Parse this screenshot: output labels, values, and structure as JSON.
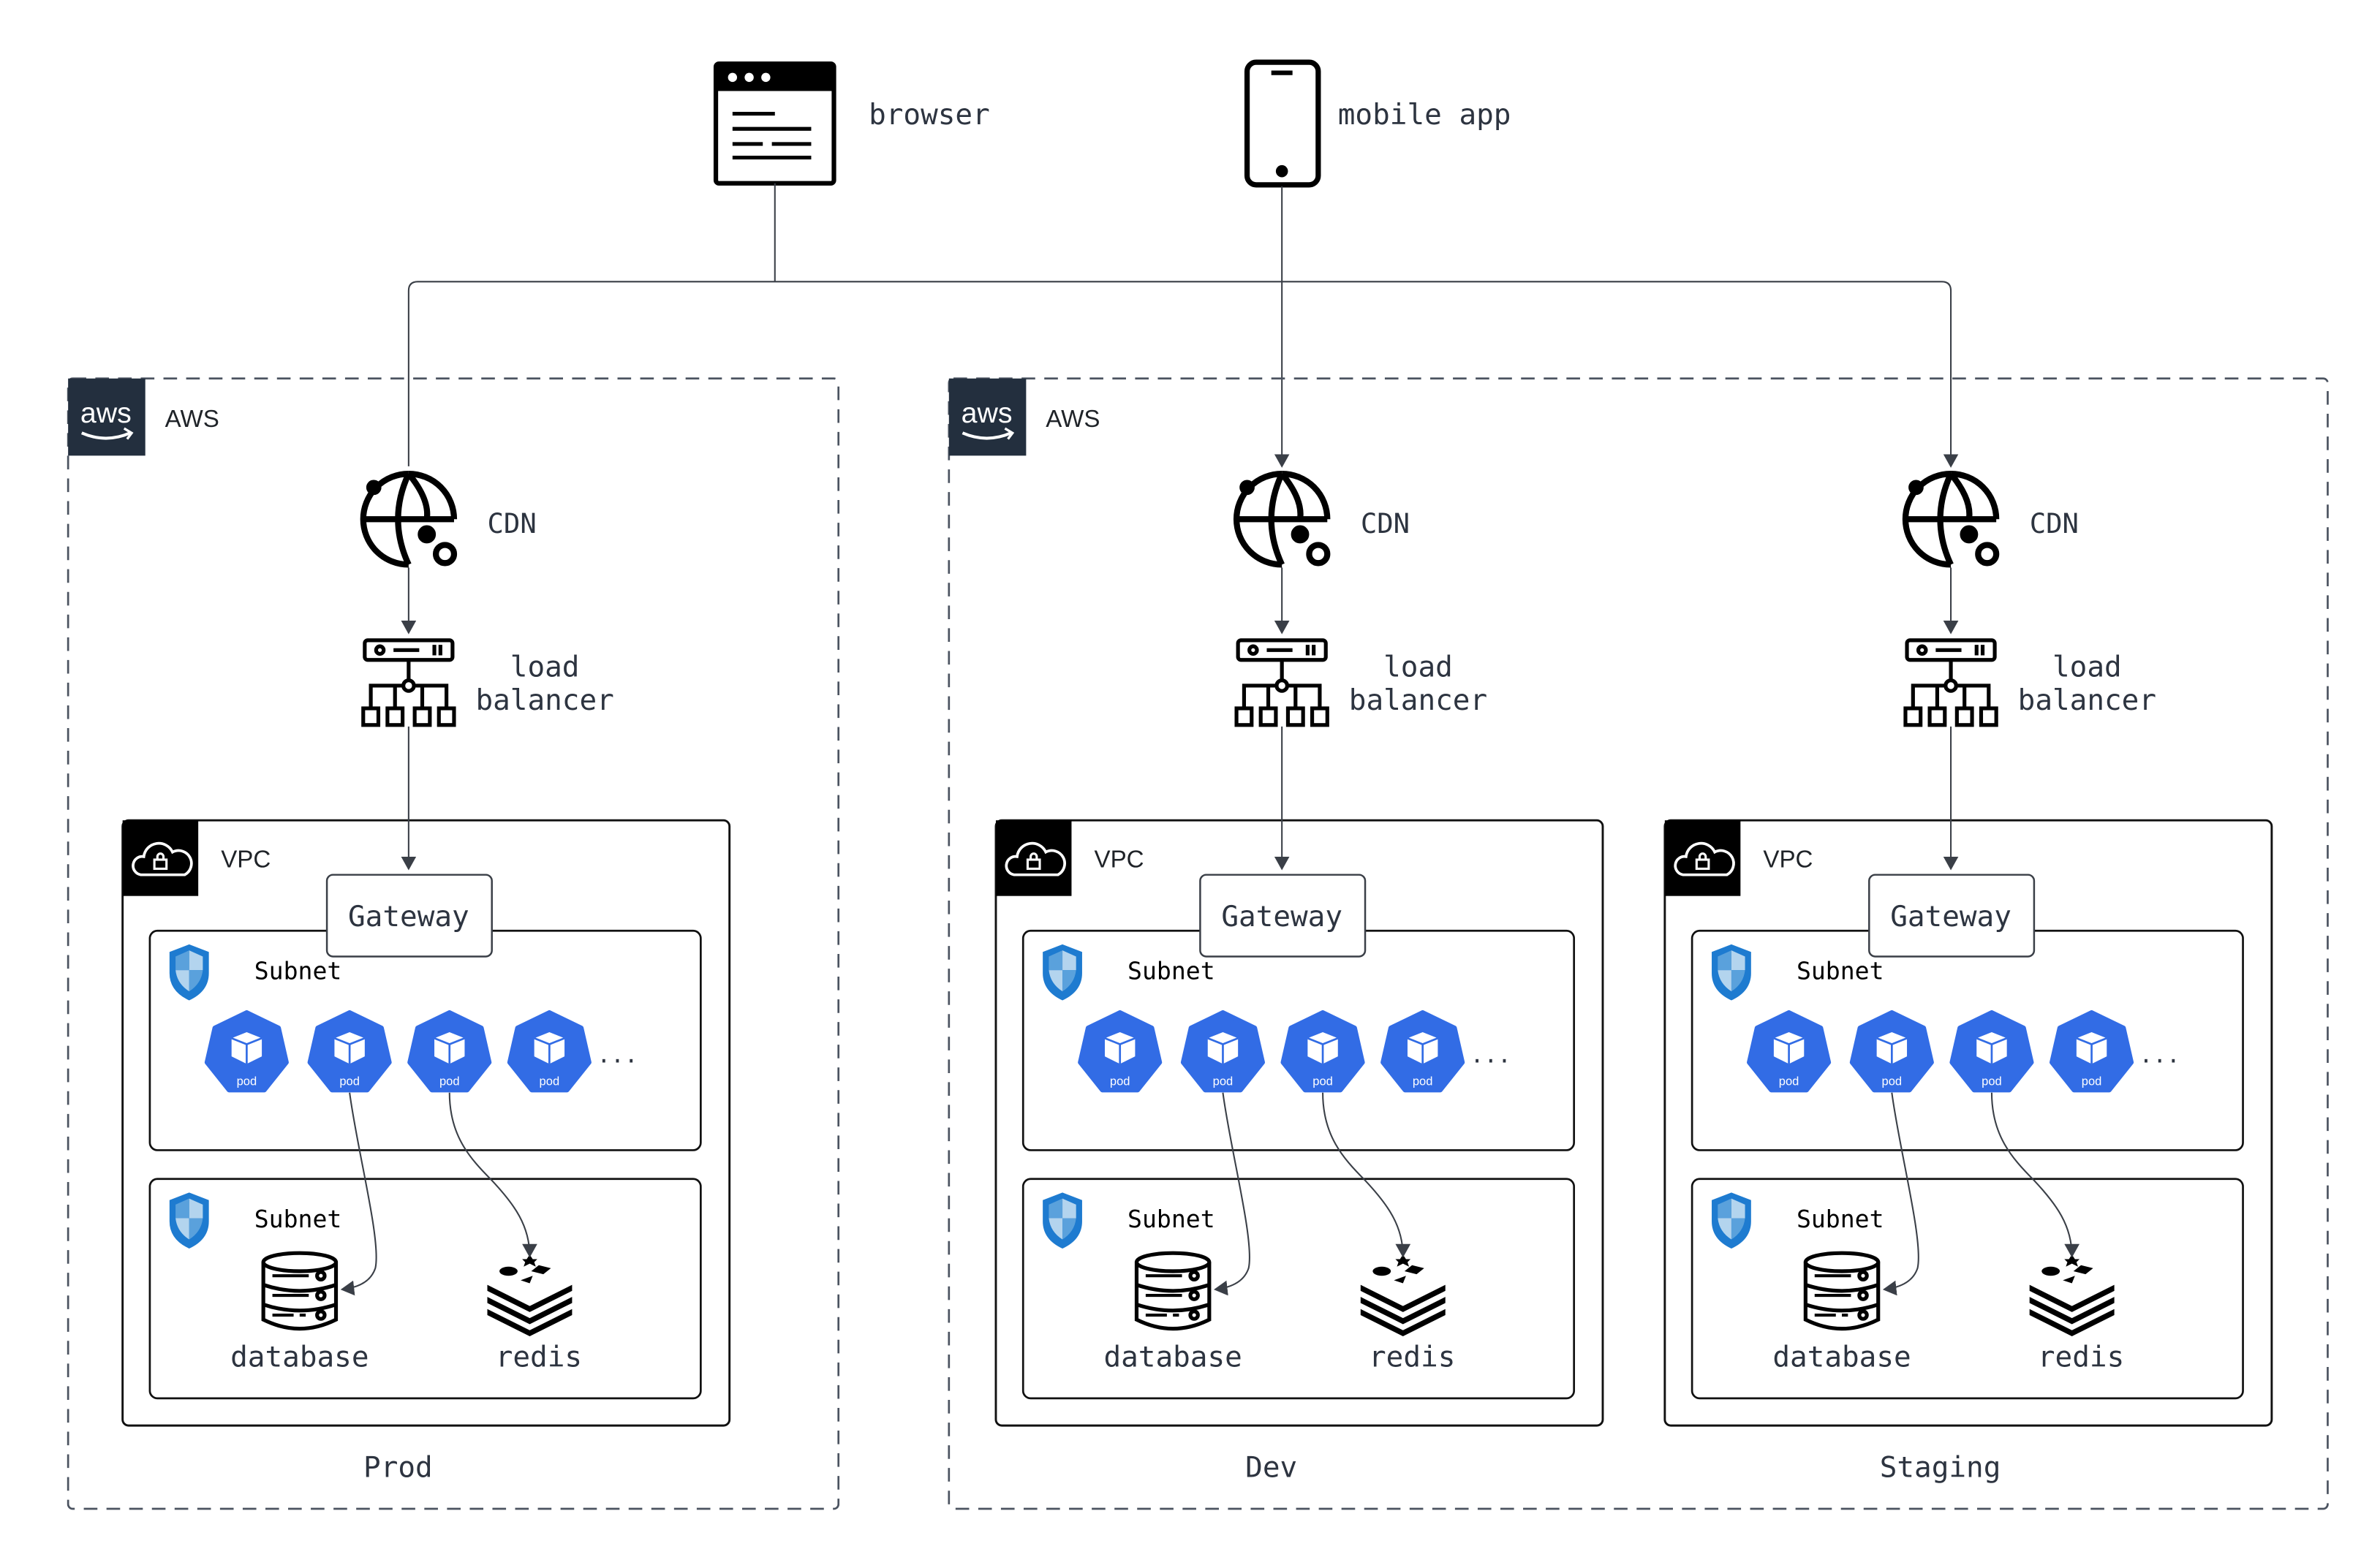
{
  "clients": {
    "browser": {
      "label": "browser",
      "icon": "browser-window-icon"
    },
    "mobile": {
      "label": "mobile app",
      "icon": "mobile-phone-icon"
    }
  },
  "providers": [
    {
      "label": "AWS",
      "logo_text": "aws",
      "icon": "aws-logo"
    },
    {
      "label": "AWS",
      "logo_text": "aws",
      "icon": "aws-logo"
    }
  ],
  "environments": [
    {
      "name": "Prod",
      "cdn": "CDN",
      "lb_line1": "load",
      "lb_line2": "balancer",
      "vpc": "VPC",
      "gateway": "Gateway",
      "subnet_app": "Subnet",
      "subnet_data": "Subnet",
      "pods": [
        "pod",
        "pod",
        "pod",
        "pod"
      ],
      "more": "...",
      "database": "database",
      "redis": "redis"
    },
    {
      "name": "Dev",
      "cdn": "CDN",
      "lb_line1": "load",
      "lb_line2": "balancer",
      "vpc": "VPC",
      "gateway": "Gateway",
      "subnet_app": "Subnet",
      "subnet_data": "Subnet",
      "pods": [
        "pod",
        "pod",
        "pod",
        "pod"
      ],
      "more": "...",
      "database": "database",
      "redis": "redis"
    },
    {
      "name": "Staging",
      "cdn": "CDN",
      "lb_line1": "load",
      "lb_line2": "balancer",
      "vpc": "VPC",
      "gateway": "Gateway",
      "subnet_app": "Subnet",
      "subnet_data": "Subnet",
      "pods": [
        "pod",
        "pod",
        "pod",
        "pod"
      ],
      "more": "...",
      "database": "database",
      "redis": "redis"
    }
  ],
  "colors": {
    "aws_logo_bg": "#232f3e",
    "pod_blue": "#326ce5",
    "shield_blue": "#1e7bd0",
    "edge": "#3a3f47"
  }
}
